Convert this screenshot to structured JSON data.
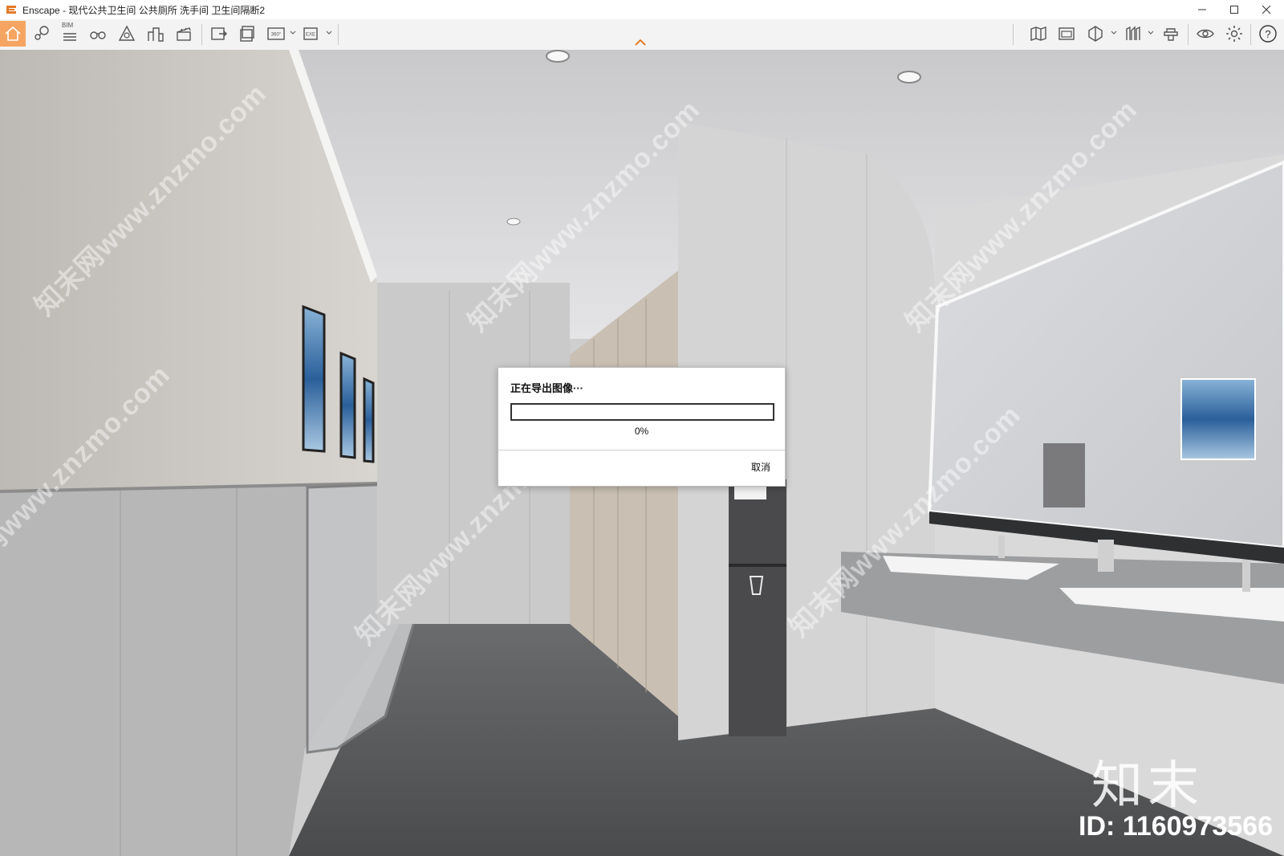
{
  "window": {
    "title": "Enscape - 现代公共卫生间 公共厕所 洗手间 卫生间隔断2",
    "controls": [
      "minimize",
      "maximize",
      "close"
    ]
  },
  "toolbar": {
    "bim_label": "BIM",
    "left_tools": [
      {
        "icon": "home-icon",
        "active": true
      },
      {
        "icon": "views-icon"
      },
      {
        "icon": "bim-properties-icon"
      },
      {
        "icon": "binoculars-icon"
      },
      {
        "icon": "asset-library-icon"
      },
      {
        "icon": "buildings-icon"
      },
      {
        "icon": "clapper-icon"
      },
      {
        "icon": "screenshot-export-icon"
      },
      {
        "icon": "batch-export-icon"
      },
      {
        "icon": "panorama-export-icon",
        "label": "360°",
        "dropdown": true
      },
      {
        "icon": "exe-export-icon",
        "label": "EXE",
        "dropdown": true
      }
    ],
    "right_tools": [
      {
        "icon": "map-icon"
      },
      {
        "icon": "visual-settings-icon"
      },
      {
        "icon": "atmosphere-icon",
        "dropdown": true
      },
      {
        "icon": "material-icon",
        "dropdown": true
      },
      {
        "icon": "hat-icon"
      },
      {
        "icon": "eye-icon"
      },
      {
        "icon": "gear-icon"
      },
      {
        "icon": "help-icon"
      }
    ],
    "accent_color": "#f5a561"
  },
  "dialog": {
    "title": "正在导出图像···",
    "progress": 0,
    "percent_text": "0%",
    "cancel_label": "取消"
  },
  "watermarks": {
    "text": "知末网www.znzmo.com",
    "brand": "知末",
    "id_text": "ID: 1160973566"
  }
}
